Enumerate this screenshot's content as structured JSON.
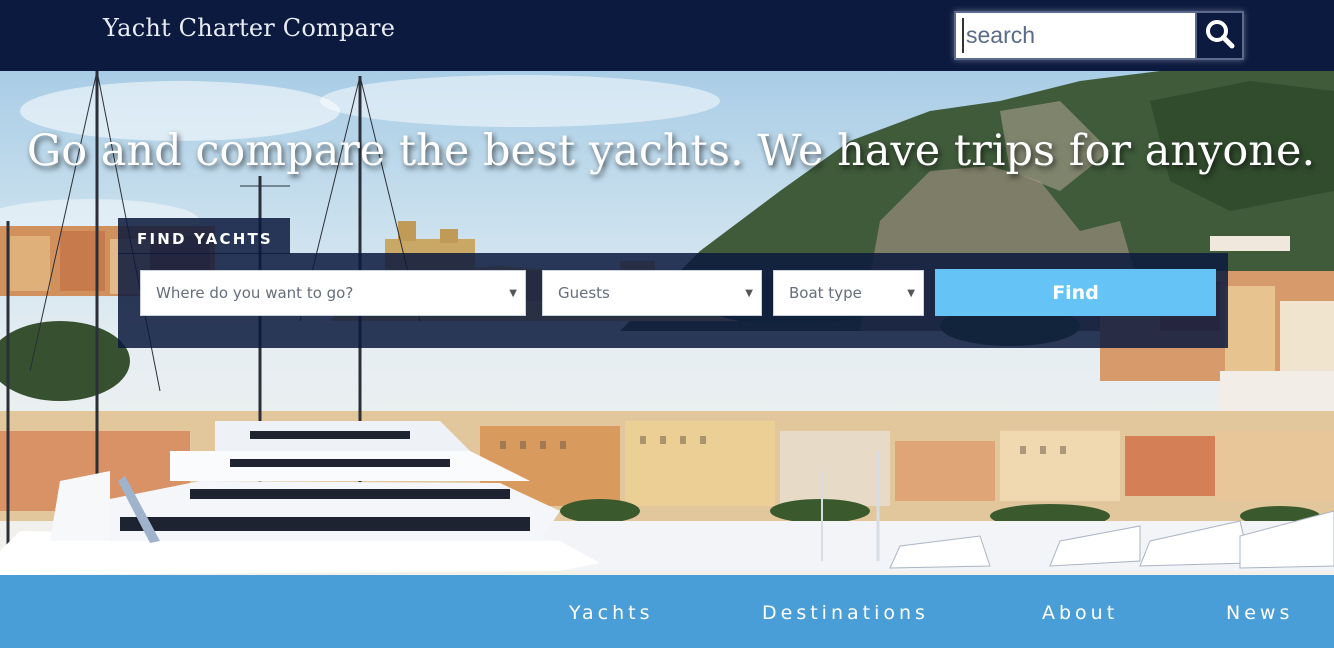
{
  "header": {
    "brand": "Yacht Charter Compare",
    "search": {
      "placeholder": "search",
      "value": ""
    },
    "search_icon": "search-icon"
  },
  "hero": {
    "headline": "Go and compare the best yachts. We have trips for anyone."
  },
  "find": {
    "title": "FIND YACHTS",
    "destination": {
      "selected": "Where do you want to go?"
    },
    "guests": {
      "selected": "Guests"
    },
    "boat_type": {
      "selected": "Boat type"
    },
    "button": "Find",
    "caret": "▼"
  },
  "nav": {
    "items": [
      {
        "label": "Yachts"
      },
      {
        "label": "Destinations"
      },
      {
        "label": "About"
      },
      {
        "label": "News"
      }
    ]
  },
  "colors": {
    "header_bg": "#0c1a3f",
    "find_button": "#66c3f6",
    "nav_bg": "#4a9ed8"
  }
}
